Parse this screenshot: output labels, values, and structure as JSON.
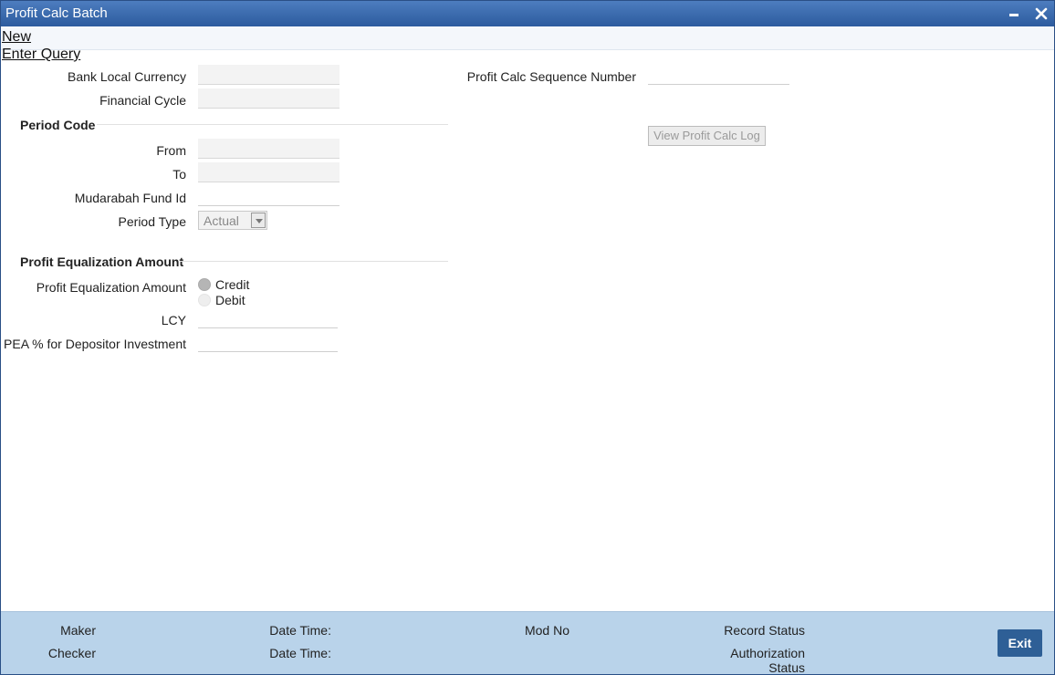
{
  "window": {
    "title": "Profit Calc Batch"
  },
  "menu": {
    "new_label": "New",
    "enter_query_label": "Enter Query"
  },
  "form": {
    "bank_local_currency": {
      "label": "Bank Local Currency",
      "value": ""
    },
    "financial_cycle": {
      "label": "Financial Cycle",
      "value": ""
    },
    "profit_calc_sequence_number": {
      "label": "Profit Calc Sequence Number",
      "value": ""
    },
    "view_log_button": "View Profit Calc Log"
  },
  "period_code": {
    "heading": "Period Code",
    "from": {
      "label": "From",
      "value": ""
    },
    "to": {
      "label": "To",
      "value": ""
    },
    "mudarabah_fund_id": {
      "label": "Mudarabah Fund Id",
      "value": ""
    },
    "period_type": {
      "label": "Period Type",
      "value": "Actual"
    }
  },
  "profit_equalization": {
    "heading": "Profit Equalization Amount",
    "amount_label": "Profit Equalization Amount",
    "options": [
      "Credit",
      "Debit"
    ],
    "selected": "Credit",
    "lcy": {
      "label": "LCY",
      "value": ""
    },
    "pea_pct": {
      "label": "PEA % for Depositor Investment",
      "value": ""
    }
  },
  "footer": {
    "maker_label": "Maker",
    "checker_label": "Checker",
    "maker_datetime_label": "Date Time:",
    "checker_datetime_label": "Date Time:",
    "mod_no_label": "Mod No",
    "record_status_label": "Record Status",
    "authorization_status_line1": "Authorization",
    "authorization_status_line2": "Status",
    "exit_label": "Exit"
  }
}
